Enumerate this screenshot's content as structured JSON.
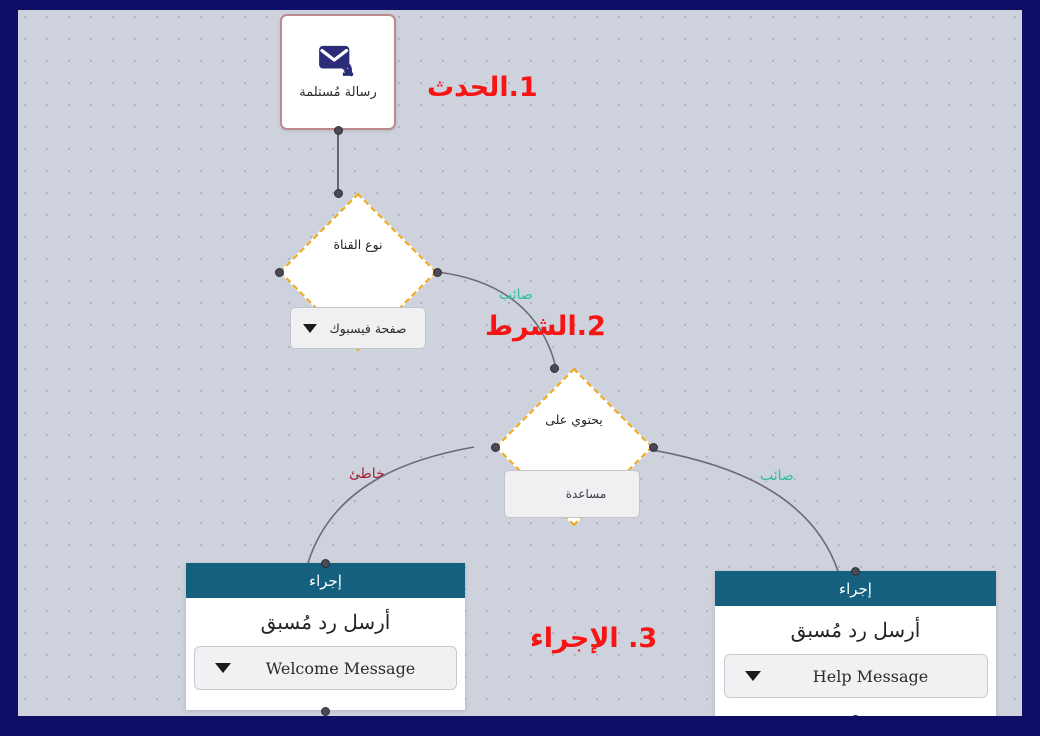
{
  "canvas": {
    "background_color": "#ced2dc",
    "border_color": "#0e0e66",
    "grid": "dotted"
  },
  "annotations": [
    {
      "id": "event",
      "text": "1.الحدث",
      "color": "#f71414"
    },
    {
      "id": "condition",
      "text": "2.الشرط",
      "color": "#f71414"
    },
    {
      "id": "action",
      "text": "3. الإجراء",
      "color": "#f71414"
    }
  ],
  "event_node": {
    "icon": "incoming-mail-icon",
    "label": "رسالة مُستلمة",
    "border_color": "#bf8a8f"
  },
  "condition_1": {
    "label": "نوع القناة",
    "border_color": "#f0a818",
    "select": {
      "value": "صفحة فيسبوك",
      "caret": "chevron-down-icon"
    }
  },
  "condition_2": {
    "label": "يحتوي على",
    "border_color": "#f0a818",
    "input": {
      "value": "مساعدة"
    }
  },
  "action_left": {
    "header": "إجراء",
    "title": "أرسل رد مُسبق",
    "header_color": "#15607f",
    "select": {
      "value": "Welcome Message",
      "caret": "chevron-down-icon"
    }
  },
  "action_right": {
    "header": "إجراء",
    "title": "أرسل رد مُسبق",
    "header_color": "#15607f",
    "select": {
      "value": "Help Message",
      "caret": "chevron-down-icon"
    }
  },
  "edge_labels": {
    "true_top": "صائب",
    "true_right": "صائب",
    "false_left": "خاطئ",
    "true_color": "#2fbf9e",
    "false_color": "#a02335"
  }
}
